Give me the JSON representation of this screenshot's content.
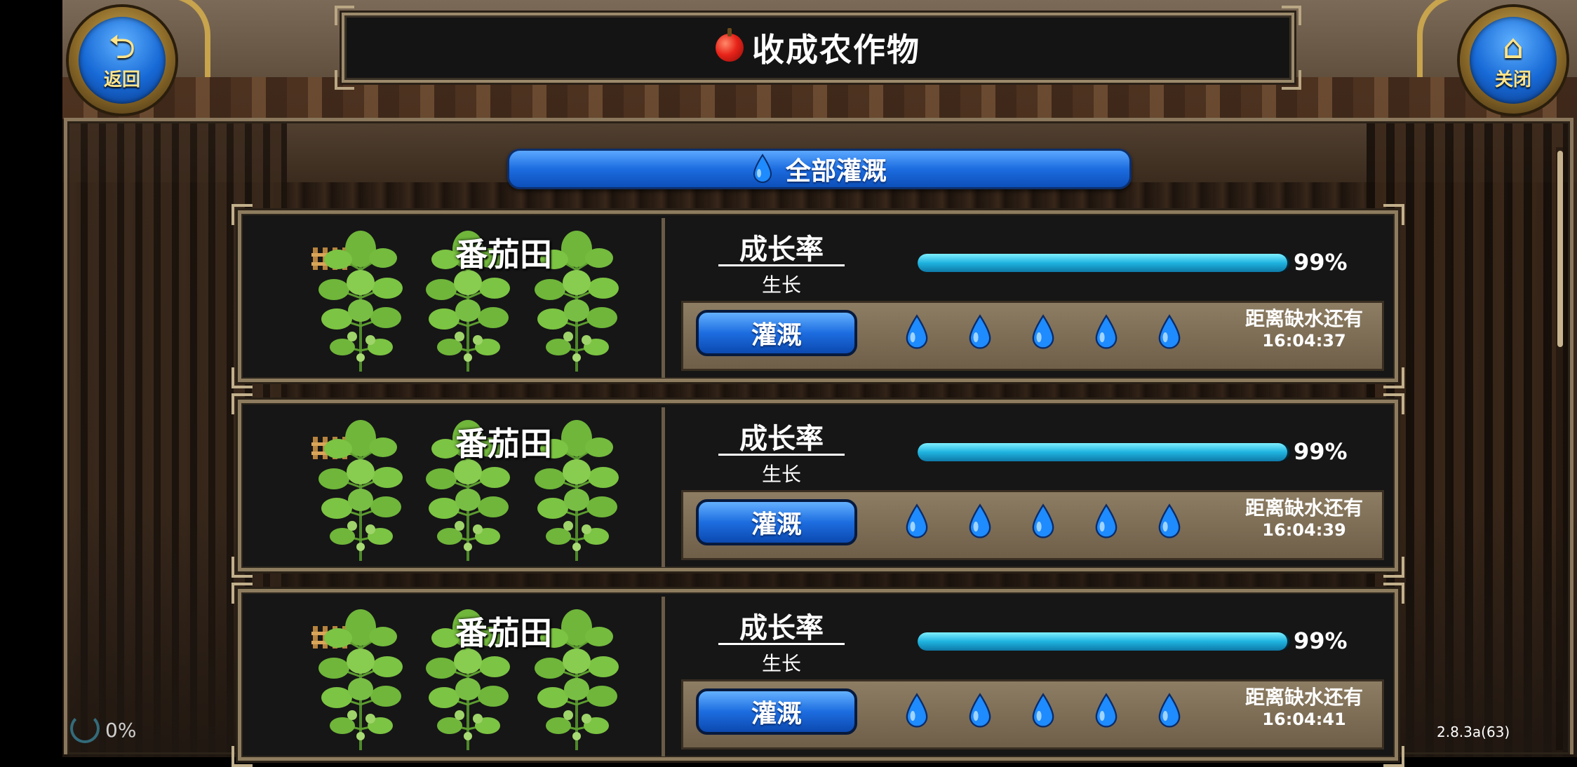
{
  "header": {
    "title": "收成农作物",
    "title_icon": "apple-icon",
    "back_label": "返回",
    "back_icon": "back-arrow-icon",
    "close_label": "关闭",
    "close_icon": "home-icon"
  },
  "water_all": {
    "label": "全部灌溉",
    "icon": "water-drop-icon"
  },
  "fields": [
    {
      "name": "番茄田",
      "growth_label": "成长率",
      "state": "生长",
      "progress": 0.99,
      "progress_text": "99%",
      "water_label": "灌溉",
      "drops": 5,
      "timer_label": "距离缺水还有",
      "timer_value": "16:04:37"
    },
    {
      "name": "番茄田",
      "growth_label": "成长率",
      "state": "生长",
      "progress": 0.99,
      "progress_text": "99%",
      "water_label": "灌溉",
      "drops": 5,
      "timer_label": "距离缺水还有",
      "timer_value": "16:04:39"
    },
    {
      "name": "番茄田",
      "growth_label": "成长率",
      "state": "生长",
      "progress": 0.99,
      "progress_text": "99%",
      "water_label": "灌溉",
      "drops": 5,
      "timer_label": "距离缺水还有",
      "timer_value": "16:04:41"
    }
  ],
  "footer": {
    "loading_percent": "0%",
    "version": "2.8.3a(63)"
  },
  "colors": {
    "accent_blue": "#1c6ce0",
    "progress_cyan": "#1fb3df",
    "frame_gold": "#8e7c5f"
  }
}
